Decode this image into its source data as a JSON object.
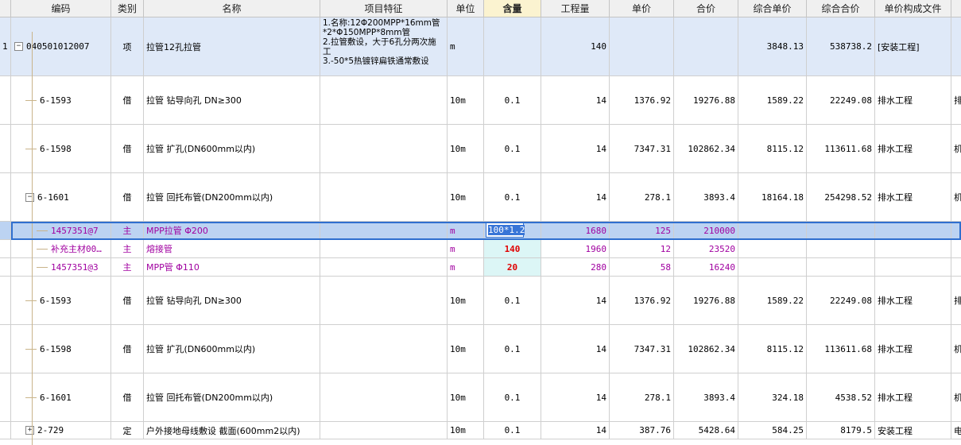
{
  "columns": [
    {
      "key": "rownum",
      "label": ""
    },
    {
      "key": "code",
      "label": "编码"
    },
    {
      "key": "type",
      "label": "类别"
    },
    {
      "key": "name",
      "label": "名称"
    },
    {
      "key": "feature",
      "label": "项目特征"
    },
    {
      "key": "unit",
      "label": "单位"
    },
    {
      "key": "content",
      "label": "含量"
    },
    {
      "key": "qty",
      "label": "工程量"
    },
    {
      "key": "price",
      "label": "单价"
    },
    {
      "key": "total",
      "label": "合价"
    },
    {
      "key": "comp_price",
      "label": "综合单价"
    },
    {
      "key": "comp_total",
      "label": "综合合价"
    },
    {
      "key": "file",
      "label": "单价构成文件"
    },
    {
      "key": "extra",
      "label": ""
    }
  ],
  "active_column": "content",
  "colors": {
    "header_bg": "#f0f0f0",
    "group_bg": "#dfe9f8",
    "selected_bg": "#bcd3f2",
    "material_text": "#a000a0",
    "red_value": "#e00000",
    "cyan_bg": "#dcf6f6"
  },
  "rows": [
    {
      "kind": "group",
      "rownum": "1",
      "code": "040501012007",
      "expander": "−",
      "type": "项",
      "name": "拉管12孔拉管",
      "feature": "1.名称:12Φ200MPP*16mm管*2*Φ150MPP*8mm管\n2.拉管敷设，大于6孔分两次施工\n3.-50*5热镀锌扁铁通常敷设",
      "unit": "m",
      "content": "",
      "qty": "140",
      "price": "",
      "total": "",
      "comp_price": "3848.13",
      "comp_total": "538738.2",
      "file": "[安装工程]",
      "extra": ""
    },
    {
      "kind": "normal",
      "rownum": "",
      "code": "6-1593",
      "type": "借",
      "name": "拉管 钻导向孔 DN≥300",
      "feature": "",
      "unit": "10m",
      "content": "0.1",
      "qty": "14",
      "price": "1376.92",
      "total": "19276.88",
      "comp_price": "1589.22",
      "comp_total": "22249.08",
      "file": "排水工程",
      "extra": "排"
    },
    {
      "kind": "normal",
      "rownum": "",
      "code": "6-1598",
      "type": "借",
      "name": "拉管 扩孔(DN600mm以内)",
      "feature": "",
      "unit": "10m",
      "content": "0.1",
      "qty": "14",
      "price": "7347.31",
      "total": "102862.34",
      "comp_price": "8115.12",
      "comp_total": "113611.68",
      "file": "排水工程",
      "extra": "机"
    },
    {
      "kind": "normal",
      "rownum": "",
      "code": "6-1601",
      "expander": "−",
      "type": "借",
      "name": "拉管 回托布管(DN200mm以内)",
      "feature": "",
      "unit": "10m",
      "content": "0.1",
      "qty": "14",
      "price": "278.1",
      "total": "3893.4",
      "comp_price": "18164.18",
      "comp_total": "254298.52",
      "file": "排水工程",
      "extra": "机"
    },
    {
      "kind": "material-selected",
      "rownum": "",
      "code": "1457351@7",
      "type": "主",
      "name": "MPP拉管 Φ200",
      "feature": "",
      "unit": "m",
      "content": "100*1.2",
      "qty": "1680",
      "price": "125",
      "total": "210000",
      "comp_price": "",
      "comp_total": "",
      "file": "",
      "extra": ""
    },
    {
      "kind": "material",
      "rownum": "",
      "code": "补充主材00…",
      "type": "主",
      "name": "熔接管",
      "feature": "",
      "unit": "m",
      "content": "140",
      "qty": "1960",
      "price": "12",
      "total": "23520",
      "comp_price": "",
      "comp_total": "",
      "file": "",
      "extra": ""
    },
    {
      "kind": "material",
      "rownum": "",
      "code": "1457351@3",
      "type": "主",
      "name": "MPP管 Φ110",
      "feature": "",
      "unit": "m",
      "content": "20",
      "qty": "280",
      "price": "58",
      "total": "16240",
      "comp_price": "",
      "comp_total": "",
      "file": "",
      "extra": ""
    },
    {
      "kind": "normal",
      "rownum": "",
      "code": "6-1593",
      "type": "借",
      "name": "拉管 钻导向孔 DN≥300",
      "feature": "",
      "unit": "10m",
      "content": "0.1",
      "qty": "14",
      "price": "1376.92",
      "total": "19276.88",
      "comp_price": "1589.22",
      "comp_total": "22249.08",
      "file": "排水工程",
      "extra": "排"
    },
    {
      "kind": "normal",
      "rownum": "",
      "code": "6-1598",
      "type": "借",
      "name": "拉管 扩孔(DN600mm以内)",
      "feature": "",
      "unit": "10m",
      "content": "0.1",
      "qty": "14",
      "price": "7347.31",
      "total": "102862.34",
      "comp_price": "8115.12",
      "comp_total": "113611.68",
      "file": "排水工程",
      "extra": "机"
    },
    {
      "kind": "normal",
      "rownum": "",
      "code": "6-1601",
      "type": "借",
      "name": "拉管 回托布管(DN200mm以内)",
      "feature": "",
      "unit": "10m",
      "content": "0.1",
      "qty": "14",
      "price": "278.1",
      "total": "3893.4",
      "comp_price": "324.18",
      "comp_total": "4538.52",
      "file": "排水工程",
      "extra": "机"
    },
    {
      "kind": "normal",
      "rownum": "",
      "code": "2-729",
      "expander": "+",
      "type": "定",
      "name": "户外接地母线敷设 截面(600mm2以内)",
      "feature": "",
      "unit": "10m",
      "content": "0.1",
      "qty": "14",
      "price": "387.76",
      "total": "5428.64",
      "comp_price": "584.25",
      "comp_total": "8179.5",
      "file": "安装工程",
      "extra": "电"
    }
  ]
}
